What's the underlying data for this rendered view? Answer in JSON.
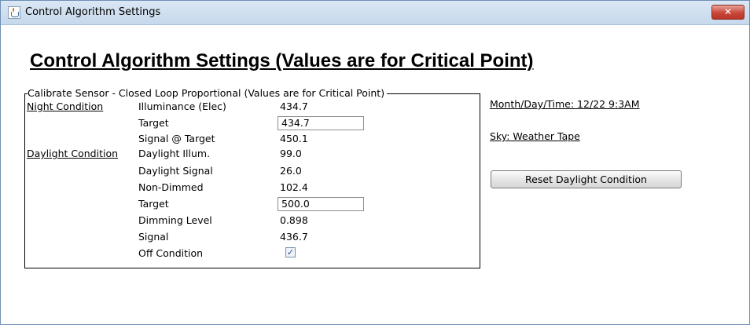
{
  "window": {
    "title": "Control Algorithm Settings",
    "close_label": "✕"
  },
  "heading": "Control Algorithm Settings (Values are for Critical Point)",
  "group": {
    "legend": "Calibrate Sensor - Closed Loop Proportional (Values are for Critical Point)",
    "night_condition": "Night Condition",
    "daylight_condition": "Daylight Condition",
    "rows": [
      {
        "label": "Illuminance (Elec)",
        "value": "434.7"
      },
      {
        "label": "Target",
        "value": "434.7"
      },
      {
        "label": "Signal @ Target",
        "value": "450.1"
      },
      {
        "label": "Daylight Illum.",
        "value": "99.0"
      },
      {
        "label": "Daylight Signal",
        "value": "26.0"
      },
      {
        "label": "Non-Dimmed",
        "value": "102.4"
      },
      {
        "label": "Target",
        "value": "500.0"
      },
      {
        "label": "Dimming Level",
        "value": "0.898"
      },
      {
        "label": "Signal",
        "value": "436.7"
      },
      {
        "label": "Off Condition",
        "checked": true,
        "check_glyph": "✓"
      }
    ]
  },
  "side": {
    "month_day_time": "Month/Day/Time: 12/22 9:3AM",
    "sky": "Sky: Weather Tape",
    "reset_button": "Reset Daylight Condition"
  }
}
